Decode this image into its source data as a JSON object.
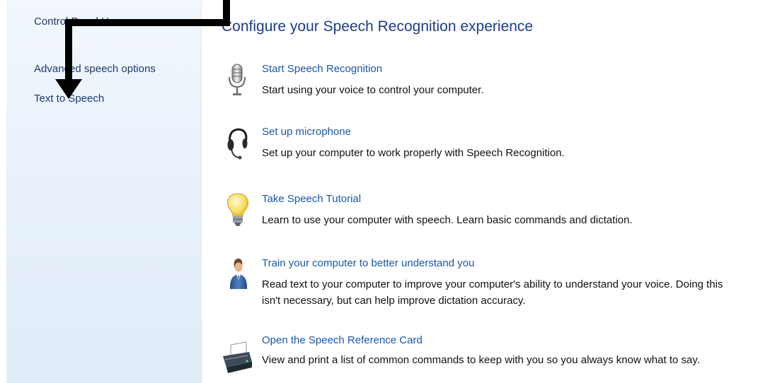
{
  "sidebar": {
    "home_label": "Control Panel Home",
    "links": [
      {
        "label": "Advanced speech options"
      },
      {
        "label": "Text to Speech"
      }
    ]
  },
  "main": {
    "title": "Configure your Speech Recognition experience",
    "tasks": [
      {
        "icon": "microphone-icon",
        "link": "Start Speech Recognition",
        "description": "Start using your voice to control your computer."
      },
      {
        "icon": "headset-icon",
        "link": "Set up microphone",
        "description": "Set up your computer to work properly with Speech Recognition."
      },
      {
        "icon": "lightbulb-icon",
        "link": "Take Speech Tutorial",
        "description": "Learn to use your computer with speech.  Learn basic commands and dictation."
      },
      {
        "icon": "user-icon",
        "link": "Train your computer to better understand you",
        "description_line1": "Read text to your computer to improve your computer's ability to understand your voice.  Doing this",
        "description_line2": "isn't necessary, but can help improve dictation accuracy."
      },
      {
        "icon": "printer-icon",
        "link": "Open the Speech Reference Card",
        "description": "View and print a list of common commands to keep with you so you always know what to say."
      }
    ]
  },
  "annotation": {
    "icon": "arrow-annotation",
    "color": "#000000"
  }
}
